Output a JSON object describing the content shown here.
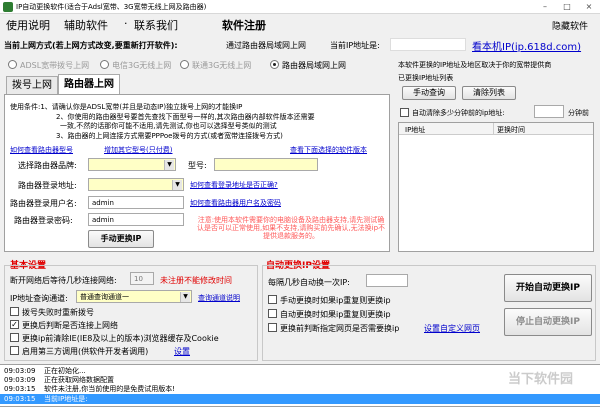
{
  "window": {
    "title": "IP自动更换软件(适合于Adsl宽带、3G宽带无线上网及路由器)",
    "min": "–",
    "max": "□",
    "close": "×"
  },
  "menu": {
    "items": [
      "使用说明",
      "辅助软件",
      "联系我们",
      "软件注册"
    ],
    "sep": "·",
    "hide": "隐藏软件"
  },
  "top": {
    "method_label": "当前上网方式(若上网方式改变,要重新打开软件):",
    "method_value": "通过路由器局域网上网",
    "ip_label": "当前IP地址是:",
    "ip_value": "",
    "check_link": "看本机IP(ip.618d.com)"
  },
  "mode_radios": [
    {
      "label": "ADSL宽带拨号上网",
      "selected": false
    },
    {
      "label": "电信3G无线上网",
      "selected": false
    },
    {
      "label": "联通3G无线上网",
      "selected": false
    },
    {
      "label": "路由器局域网上网",
      "selected": true
    }
  ],
  "tabs": [
    {
      "label": "拨号上网",
      "active": false
    },
    {
      "label": "路由器上网",
      "active": true
    }
  ],
  "conditions": {
    "line1": "使用条件:1、请确认你是ADSL宽带(并且是动态IP)独立拨号上网的才能换IP",
    "line2": "2、你使用的路由器型号要首先查找下面型号一样的,其次路由器内部软件版本还需要",
    "line3": "一致,不然的话那你可能不适用,请先测试,你也可以选择型号类似的测试",
    "line4": "3、路由器的上网连接方式需要PPPoe拨号的方式(或者宽带连接拨号方式)"
  },
  "router": {
    "view_models_link": "如何查看路由器型号",
    "add_model_link": "增加其它型号(只付费)",
    "view_versions_link": "查看下面选择的软件版本",
    "brand_label": "选择路由器品牌:",
    "brand_value": "",
    "model_label": "型号:",
    "model_value": "",
    "login_label": "路由器登录地址:",
    "login_value": "",
    "login_help_link": "如何查看登录地址是否正确?",
    "user_label": "路由器登录用户名:",
    "user_value": "admin",
    "user_help_link": "如何查看路由器用户名及密码",
    "pass_label": "路由器登录密码:",
    "pass_value": "admin",
    "manual_button": "手动更换IP",
    "notice": "注意:使用本软件需要你的电脑设备及路由器支持,请先测试确认是否可以正常使用,如果不支持,请购买前先确认,无法换ip不提供退款服务的。"
  },
  "right_top": {
    "desc": "本软件更换的IP地址及地区取决于你的宽带提供商",
    "list_label": "已更换IP地址列表",
    "query_button": "手动查询",
    "clear_button": "清除列表",
    "auto_clear_label": "自动清除多少分钟前的ip地址:",
    "minutes_value": "",
    "minutes_unit": "分钟前",
    "col1": "IP地址",
    "col2": "更换时间"
  },
  "basic": {
    "title": "基本设置",
    "wait_label": "断开网络后等待几秒连接网络:",
    "wait_value": "10",
    "wait_hint": "未注册不能修改时间",
    "query_channel_label": "IP地址查询通道:",
    "query_channel_value": "普通查询通道一",
    "query_test_link": "查询通道说明",
    "opt1": "拨号失败时重新拨号",
    "opt2": "更换后判断是否连接上网络",
    "opt3": "更换ip前清除IE(IE8及以上的版本)浏览器缓存及Cookie",
    "opt4": "启用第三方调用(供软件开发者调用)",
    "opt4_link": "设置"
  },
  "auto": {
    "title": "自动更换IP设置",
    "interval_label": "每隔几秒自动换一次IP:",
    "interval_value": "",
    "opt1": "手动更换时如果ip重复则更换ip",
    "opt2": "自动更换时如果ip重复则更换ip",
    "opt3": "更换前判断指定网页是否需要换ip",
    "opt3_link": "设置自定义网页",
    "start_button": "开始自动更换IP",
    "stop_button": "停止自动更换IP"
  },
  "log": [
    {
      "time": "09:03:09",
      "text": "正在初始化...",
      "highlight": false
    },
    {
      "time": "09:03:09",
      "text": "正在获取网络数据配置",
      "highlight": false
    },
    {
      "time": "09:03:15",
      "text": "软件未注册,你当前使用的是免费试用版本!",
      "highlight": false
    },
    {
      "time": "09:03:15",
      "text": "当前IP地址是:",
      "highlight": true
    }
  ],
  "watermark": "当下软件园",
  "colors": {
    "accent_red": "#e00000",
    "link_blue": "#0000cc",
    "highlight_row": "#3399ff",
    "notice_red": "#ff5a5a"
  }
}
